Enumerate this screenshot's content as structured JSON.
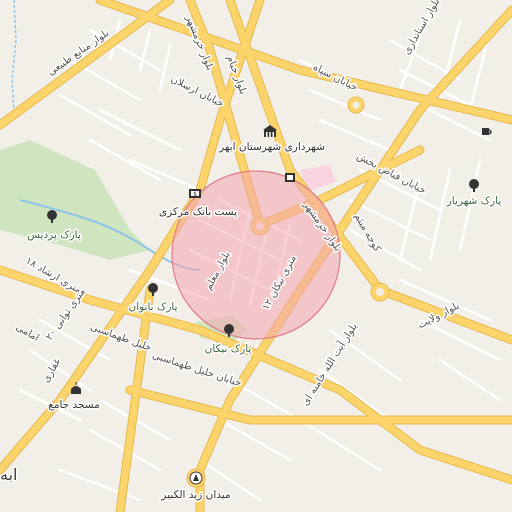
{
  "map": {
    "colors": {
      "background": "#f2efe9",
      "major_road": "#fcd46c",
      "major_road_casing": "#e6b94e",
      "minor_road": "#ffffff",
      "park": "#cfe5c0",
      "stream": "#8ec4e8",
      "highlight_fill": "#f4a6b0",
      "highlight_stroke": "#e07a8a",
      "poi_icon": "#333333",
      "pink_area": "#f8d3e0"
    },
    "road_labels": {
      "manabe_tabiei": "بلوار منابع طبیعی",
      "khorramshahr_top": "بلوار خرمشهر",
      "khayyam_top": "بلوار خیام",
      "ostandari": "بلوار استانداری",
      "arsalan": "خیابان ارسلان",
      "sepah": "خیابان سپاه",
      "feyz_bakhsh": "خیابان فیاض بخش",
      "kooche_meysam": "کوچه میثم",
      "khorramshahr_mid": "بلوار خرمشهر",
      "moallem": "بلوار معلم",
      "metri_12": "۱۲ متری نیکان",
      "metri_18": "۱۸ متری ارشاد",
      "metri_20": "۲۰ متری ثوانی",
      "imami": "امامی",
      "ghafari": "غفاری",
      "tahmasebi": "خلیل طهماسبی",
      "khalil_tahmasebi": "خیابان خلیل طهماسبی",
      "velayat": "بلوار ولایت",
      "khamenei": "بلوار آیت الله خامنه ای"
    },
    "pois": {
      "city_hall": "شهرداری شهرستان ابهر",
      "post_bank": "پست بانک مرکزی",
      "pardis_park": "پارک پردیس",
      "banovan_park": "پارک بانوان",
      "nikan_park": "پارک نیکان",
      "shahriar_park": "پارک شهریار",
      "jame_mosque": "مسجد جامع",
      "zeid_square": "میدان زید الکبیر",
      "city_edge": "ابه"
    },
    "highlight": {
      "shape": "circle",
      "center_label": ""
    }
  }
}
